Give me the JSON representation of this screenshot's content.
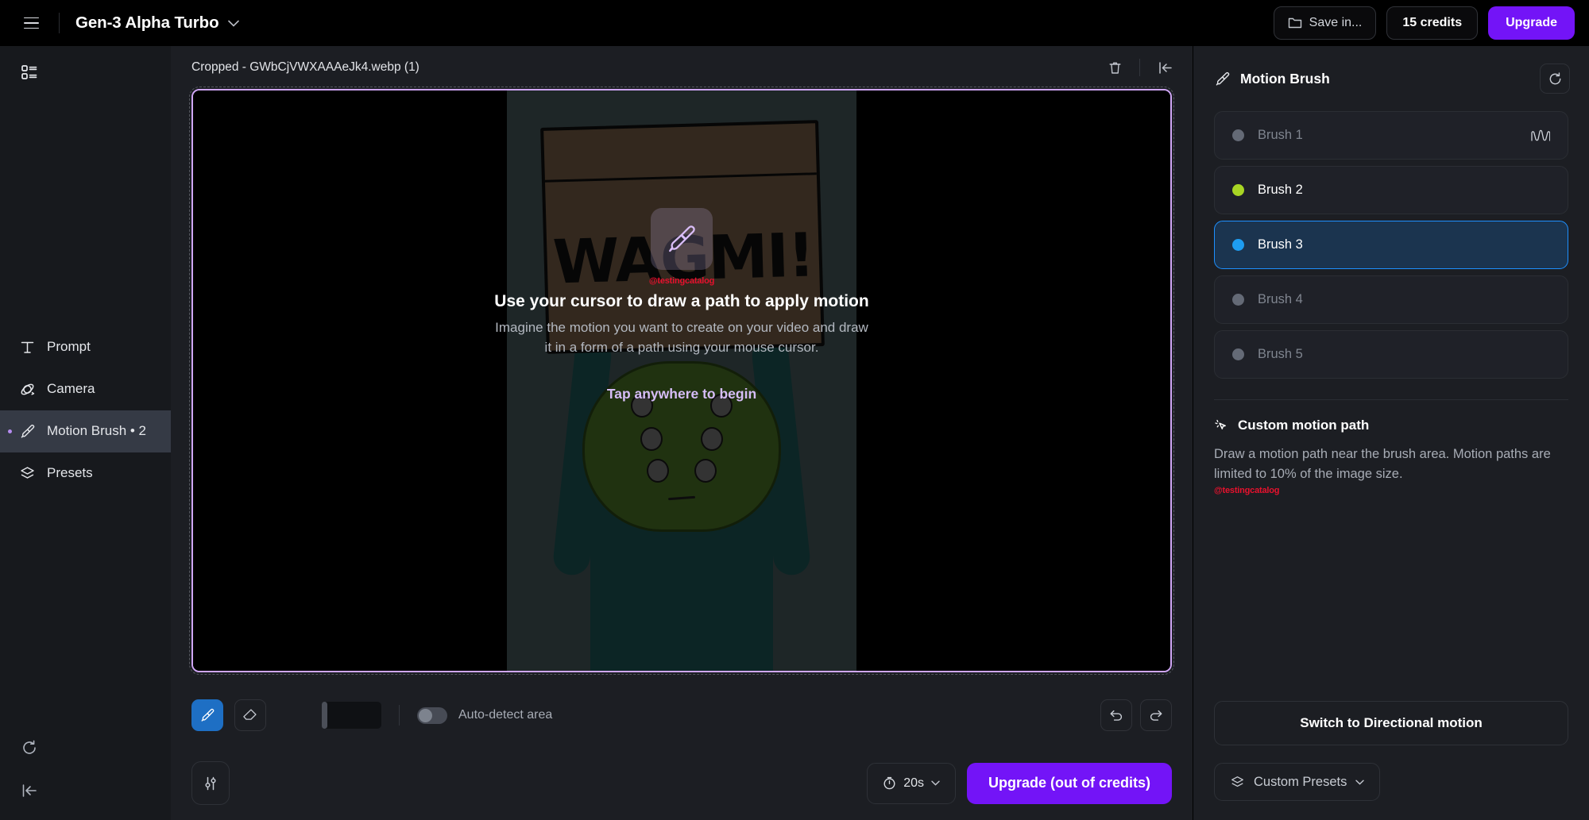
{
  "topbar": {
    "menu_icon": "hamburger-menu-icon",
    "model_name": "Gen-3 Alpha Turbo",
    "model_chevron": "⌄",
    "save_in_label": "Save in...",
    "save_in_icon": "folder-icon",
    "credits_label": "15 credits",
    "upgrade_label": "Upgrade"
  },
  "left_rail": {
    "grid_icon": "list-view-icon",
    "items": [
      {
        "label": "Prompt",
        "icon": "text-t-icon",
        "active": false
      },
      {
        "label": "Camera",
        "icon": "camera-orbit-icon",
        "active": false
      },
      {
        "label": "Motion Brush • 2",
        "icon": "paint-brush-icon",
        "active": true
      },
      {
        "label": "Presets",
        "icon": "layers-icon",
        "active": false
      }
    ],
    "bottom": [
      {
        "icon": "history-reset-icon",
        "name": "history-button"
      },
      {
        "icon": "collapse-left-icon",
        "name": "collapse-sidebar-button"
      }
    ]
  },
  "canvas": {
    "file_name": "Cropped - GWbCjVWXAAAeJk4.webp (1)",
    "delete_icon": "trash-icon",
    "collapse_icon": "collapse-panel-icon",
    "image_sign_text": "WAGMI!",
    "overlay": {
      "brush_icon": "paint-brush-icon",
      "watermark": "@testingcatalog",
      "title": "Use your cursor to draw a path to apply motion",
      "subtitle": "Imagine the motion you want to create on your video and draw it in a form of a path using your mouse cursor.",
      "tap_label": "Tap anywhere to begin"
    },
    "toolbar": {
      "brush_tool_icon": "paint-brush-icon",
      "eraser_tool_icon": "eraser-icon",
      "brush_size_label": "",
      "auto_detect_label": "Auto-detect area",
      "auto_detect_on": false,
      "undo_icon": "undo-arrow-icon",
      "redo_icon": "redo-arrow-icon"
    }
  },
  "bottombar": {
    "settings_icon": "sliders-icon",
    "duration_label": "20s",
    "duration_icon": "timer-icon",
    "duration_chevron": "⌄",
    "generate_label": "Upgrade (out of credits)"
  },
  "right_panel": {
    "title": "Motion Brush",
    "title_icon": "paint-brush-icon",
    "reset_icon": "reset-circular-arrow-icon",
    "brushes": [
      {
        "label": "Brush 1",
        "color": "#646a76",
        "selected": false,
        "has_path": true,
        "wave_icon": "waveform-icon"
      },
      {
        "label": "Brush 2",
        "color": "#a8d524",
        "selected": false,
        "has_path": true,
        "wave_icon": ""
      },
      {
        "label": "Brush 3",
        "color": "#1e9df1",
        "selected": true,
        "has_path": true,
        "wave_icon": ""
      },
      {
        "label": "Brush 4",
        "color": "#646a76",
        "selected": false,
        "has_path": false,
        "wave_icon": ""
      },
      {
        "label": "Brush 5",
        "color": "#646a76",
        "selected": false,
        "has_path": false,
        "wave_icon": ""
      }
    ],
    "custom_motion_path": {
      "icon": "cursor-sparkle-icon",
      "title": "Custom motion path",
      "description": "Draw a motion path near the brush area. Motion paths are limited to 10% of the image size.",
      "watermark": "@testingcatalog"
    },
    "switch_label": "Switch to Directional motion",
    "presets_label": "Custom Presets",
    "presets_icon": "layers-icon",
    "presets_chevron": "⌄"
  },
  "colors": {
    "accent_purple": "#7314f7",
    "selected_blue": "#1e90ff",
    "canvas_border": "#cfa6f5",
    "watermark_red": "#e8112d"
  }
}
